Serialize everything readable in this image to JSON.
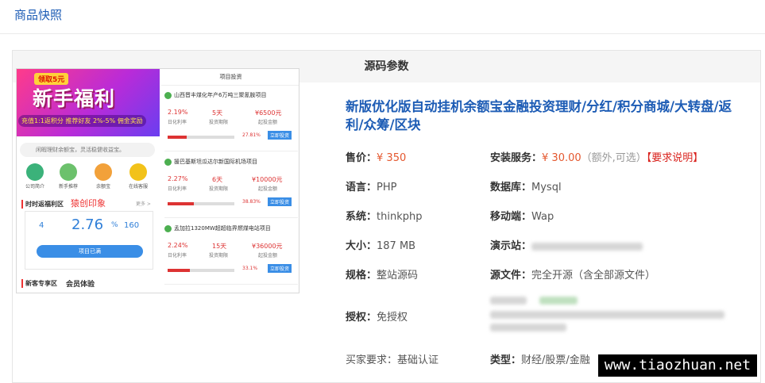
{
  "header": {
    "title": "商品快照"
  },
  "panel": {
    "title": "源码参数"
  },
  "thumbnail": {
    "banner": {
      "tag": "领取5元",
      "big": "新手福利",
      "sub": "充值1:1返积分 推荐好友 2%-5% 佣金奖励"
    },
    "notice": "闲暇理财余额宝，灵活稳健收益宝。",
    "icons": [
      {
        "name": "company-icon",
        "label": "公司简介",
        "color": "#3bb27a"
      },
      {
        "name": "invite-icon",
        "label": "新手推荐",
        "color": "#6cc16c"
      },
      {
        "name": "yuebao-icon",
        "label": "余额宝",
        "color": "#f2a13a"
      },
      {
        "name": "service-icon",
        "label": "在线客服",
        "color": "#f2c21a"
      }
    ],
    "timed": "时时返福利区",
    "signature": "猿创印象",
    "more": "更多 >",
    "rate": {
      "left_val": "4",
      "main_val": "2.76",
      "right_val": "160",
      "unit": "%",
      "btn": "项目已满"
    },
    "newzone": "新客专享区",
    "newzone_sub": "会员体验",
    "right_head": "项目投资",
    "projects": [
      {
        "title": "山西晋丰煤化年产6万吨三聚氰胺项目",
        "rate": "2.19%",
        "days": "5天",
        "amount": "¥6500元",
        "pct": "27.81%",
        "fill": 0.28
      },
      {
        "title": "援巴基斯坦瓜达尔新国际机场项目",
        "rate": "2.27%",
        "days": "6天",
        "amount": "¥10000元",
        "pct": "38.83%",
        "fill": 0.39
      },
      {
        "title": "孟加拉1320MW超超临界燃煤电站项目",
        "rate": "2.24%",
        "days": "15天",
        "amount": "¥36000元",
        "pct": "33.1%",
        "fill": 0.33
      }
    ],
    "row_labels": {
      "rate": "日化利率",
      "period": "投资期限",
      "start": "起投金额"
    },
    "invest_btn": "立即投资"
  },
  "product": {
    "title": "新版优化版自动挂机余额宝金融投资理财/分红/积分商城/大转盘/返利/众筹/区块",
    "price_label": "售价：",
    "price": "¥ 350",
    "install_label": "安装服务：",
    "install_price": "¥ 30.00",
    "install_note": "（额外,可选）",
    "install_req": "【要求说明】",
    "lang_label": "语言：",
    "lang": "PHP",
    "db_label": "数据库：",
    "db": "Mysql",
    "sys_label": "系统：",
    "sys": "thinkphp",
    "mobile_label": "移动端：",
    "mobile": "Wap",
    "size_label": "大小：",
    "size": "187 MB",
    "demo_label": "演示站：",
    "spec_label": "规格：",
    "spec": "整站源码",
    "files_label": "源文件：",
    "files": "完全开源（含全部源文件）",
    "auth_label": "授权：",
    "auth": "免授权",
    "buyer_label": "买家要求：",
    "buyer": "基础认证",
    "type_label": "类型：",
    "type": "财经/股票/金融"
  },
  "watermark": "www.tiaozhuan.net"
}
